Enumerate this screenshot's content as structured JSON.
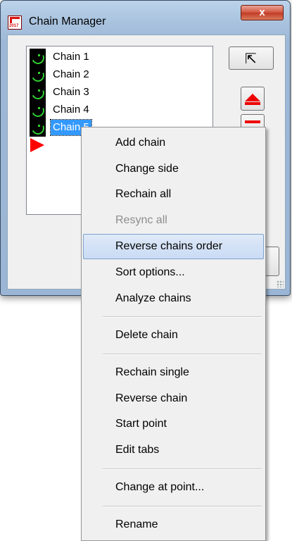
{
  "window": {
    "title": "Chain Manager",
    "close_glyph": "x",
    "app_icon": "chain-manager-app-icon",
    "app_icon_text": "2017"
  },
  "chains": [
    {
      "label": "Chain 1",
      "icon": "chain-icon"
    },
    {
      "label": "Chain 2",
      "icon": "chain-icon"
    },
    {
      "label": "Chain 3",
      "icon": "chain-icon"
    },
    {
      "label": "Chain 4",
      "icon": "chain-icon"
    },
    {
      "label": "Chain 5",
      "icon": "chain-icon",
      "selected": true
    }
  ],
  "buttons": {
    "select_icon": "cursor-arrow-icon",
    "move_up_icon": "move-up-icon",
    "move_down_icon": "move-down-icon",
    "cursor_glyph": "⇱"
  },
  "context_menu": {
    "items": [
      {
        "label": "Add chain"
      },
      {
        "label": "Change side"
      },
      {
        "label": "Rechain all"
      },
      {
        "label": "Resync all",
        "disabled": true
      },
      {
        "label": "Reverse chains order",
        "highlighted": true
      },
      {
        "label": "Sort options..."
      },
      {
        "label": "Analyze chains"
      },
      {
        "label": "Delete chain"
      },
      {
        "label": "Rechain single"
      },
      {
        "label": "Reverse chain"
      },
      {
        "label": "Start point"
      },
      {
        "label": "Edit tabs"
      },
      {
        "label": "Change at point..."
      },
      {
        "label": "Rename"
      }
    ]
  },
  "colors": {
    "selection": "#3399ff",
    "marker": "#ff0000",
    "chain_icon_stroke": "#2fd12f",
    "menu_highlight_border": "#7da2ce"
  }
}
